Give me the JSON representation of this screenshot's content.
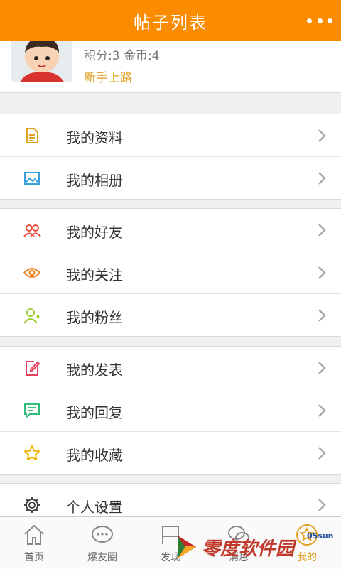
{
  "header": {
    "title": "帖子列表",
    "more_icon": "more-dots-icon"
  },
  "profile": {
    "score_text": "积分:3 金币:4",
    "rank": "新手上路"
  },
  "menu_groups": [
    [
      {
        "label": "我的资料",
        "icon": "document-icon",
        "color": "#e0a020"
      },
      {
        "label": "我的相册",
        "icon": "image-icon",
        "color": "#3ba0dc"
      }
    ],
    [
      {
        "label": "我的好友",
        "icon": "friends-icon",
        "color": "#e74c3c"
      },
      {
        "label": "我的关注",
        "icon": "eye-icon",
        "color": "#f08020"
      },
      {
        "label": "我的粉丝",
        "icon": "add-user-icon",
        "color": "#9ccc35"
      }
    ],
    [
      {
        "label": "我的发表",
        "icon": "edit-icon",
        "color": "#e8405a"
      },
      {
        "label": "我的回复",
        "icon": "reply-icon",
        "color": "#2ebd7a"
      },
      {
        "label": "我的收藏",
        "icon": "star-icon",
        "color": "#f0b400"
      }
    ],
    [
      {
        "label": "个人设置",
        "icon": "gear-icon",
        "color": "#444444"
      }
    ]
  ],
  "tabs": [
    {
      "label": "首页",
      "icon": "home-icon"
    },
    {
      "label": "爆友圈",
      "icon": "chat-bubble-icon"
    },
    {
      "label": "发现",
      "icon": "flag-icon"
    },
    {
      "label": "消息",
      "icon": "message-icon"
    },
    {
      "label": "我的",
      "icon": "star-circle-icon"
    }
  ],
  "watermark": {
    "text": "零度软件园",
    "small": "05sun"
  },
  "colors": {
    "accent": "#fb8c00",
    "rank": "#e0a020"
  }
}
